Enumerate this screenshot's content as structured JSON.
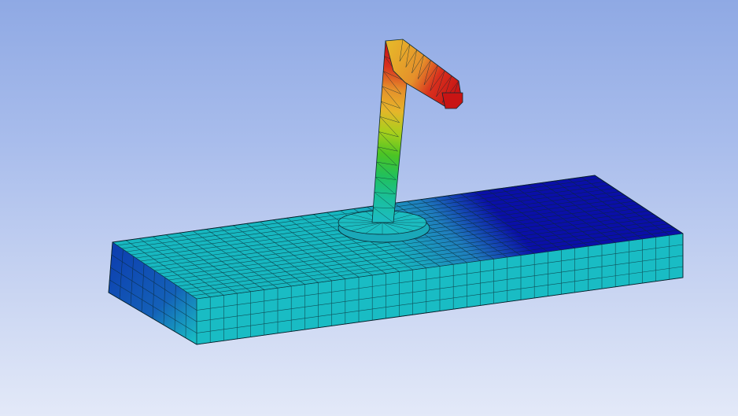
{
  "viewport": {
    "background_top": "#8fa9e4",
    "background_bottom": "#e3e9f8"
  },
  "model": {
    "plate": {
      "top_near_color": "#17b7c0",
      "top_far_color": "#0a0fa8",
      "top_mid_color": "#1f7dbd",
      "front_color": "#19bcc4",
      "left_color": "#0d3fb0",
      "mesh_color": "#0b2a33"
    },
    "post": {
      "base_color": "#1cbcc0",
      "gradient": [
        "#1cbcc0",
        "#1abf9a",
        "#21c05c",
        "#4cc424",
        "#a6cf1c",
        "#e6b52a",
        "#e58f2b",
        "#d8301d",
        "#c81414"
      ]
    }
  }
}
